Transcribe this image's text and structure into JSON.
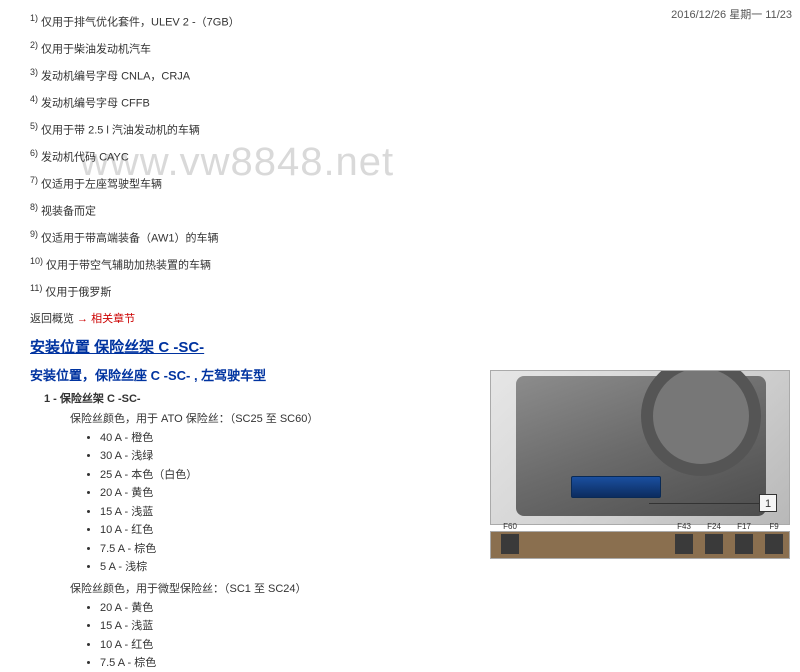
{
  "timestamp": "2016/12/26 星期一 11/23",
  "watermark": "www.vw8848.net",
  "footnotes": {
    "n1": "仅用于排气优化套件，ULEV 2 -（7GB）",
    "n2": "仅用于柴油发动机汽车",
    "n3": "发动机编号字母 CNLA，CRJA",
    "n4": "发动机编号字母 CFFB",
    "n5": "仅用于带 2.5 l 汽油发动机的车辆",
    "n6": "发动机代码 CAYC",
    "n7": "仅适用于左座驾驶型车辆",
    "n8": "视装备而定",
    "n9": "仅适用于带高端装备（AW1）的车辆",
    "n10": "仅用于带空气辅助加热装置的车辆",
    "n11": "仅用于俄罗斯"
  },
  "back": {
    "label": "返回概览",
    "link": " → 相关章节"
  },
  "section_heading": "安装位置 保险丝架 C -SC-",
  "sub_heading": "安装位置，保险丝座 C -SC- , 左驾驶车型",
  "item_heading": "1 - 保险丝架 C -SC-",
  "desc_ato": "保险丝颜色，用于 ATO 保险丝：（SC25 至 SC60）",
  "ato_list": [
    "40 A - 橙色",
    "30 A - 浅绿",
    "25 A - 本色（白色）",
    "20 A - 黄色",
    "15 A - 浅蓝",
    "10 A - 红色",
    "7.5 A - 棕色",
    "5 A - 浅棕"
  ],
  "desc_mini": "保险丝颜色，用于微型保险丝：（SC1 至 SC24）",
  "mini_list": [
    "20 A - 黄色",
    "15 A - 浅蓝",
    "10 A - 红色",
    "7.5 A - 棕色"
  ],
  "figure": {
    "callout1": "1",
    "bottom_labels": {
      "left": "F60",
      "r1": "F43",
      "r2": "F24",
      "r3": "F17",
      "r4": "F9"
    }
  }
}
